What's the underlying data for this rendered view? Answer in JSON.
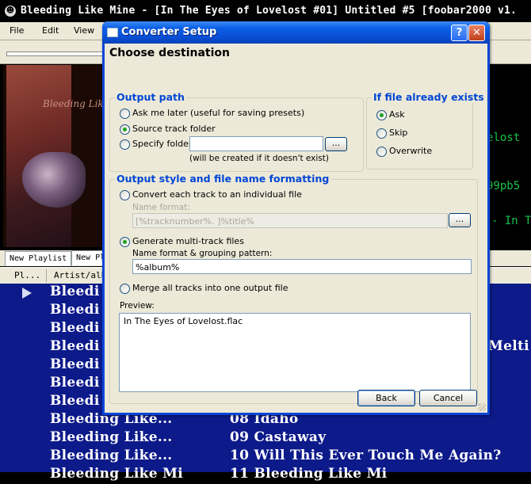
{
  "app": {
    "window_title": "Bleeding Like Mine - [In The Eyes of Lovelost #01] Untitled #5   [foobar2000 v1.",
    "menu": [
      "File",
      "Edit",
      "View"
    ],
    "info_lines": [
      "elost",
      "99pb5",
      "- In T"
    ],
    "cover_text": "Bleeding Like",
    "playlist_tabs": [
      "New Playlist",
      "New Pl"
    ],
    "columns": [
      "Pl...",
      "Artist/alb"
    ],
    "playlist_rows": [
      {
        "artist": "Bleedi",
        "title": "",
        "playing": true
      },
      {
        "artist": "Bleedi",
        "title": ""
      },
      {
        "artist": "Bleedi",
        "title": ""
      },
      {
        "artist": "Bleedi",
        "title": "Melti"
      },
      {
        "artist": "Bleedi",
        "title": ""
      },
      {
        "artist": "Bleedi",
        "title": ""
      },
      {
        "artist": "Bleedi",
        "title": ""
      },
      {
        "artist": "Bleeding Like...",
        "title": "08 Idaho"
      },
      {
        "artist": "Bleeding Like...",
        "title": "09 Castaway"
      },
      {
        "artist": "Bleeding Like...",
        "title": "10 Will This Ever Touch Me Again?"
      },
      {
        "artist": "Bleeding Like Mi",
        "title": "11 Bleeding Like Mi"
      }
    ]
  },
  "dialog": {
    "title": "Converter Setup",
    "help_glyph": "?",
    "close_glyph": "✕",
    "heading": "Choose destination",
    "output_path": {
      "title": "Output path",
      "options": [
        "Ask me later (useful for saving presets)",
        "Source track folder",
        "Specify folder:"
      ],
      "selected": 1,
      "folder_value": "",
      "browse_label": "...",
      "note": "(will be created if it doesn't exist)"
    },
    "if_exists": {
      "title": "If file already exists",
      "options": [
        "Ask",
        "Skip",
        "Overwrite"
      ],
      "selected": 0
    },
    "output_style": {
      "title": "Output style and file name formatting",
      "individual_label": "Convert each track to an individual file",
      "name_format_label": "Name format:",
      "name_format_value": "[%tracknumber%. ]%title%",
      "browse_label": "...",
      "multitrack_label": "Generate multi-track files",
      "grouping_label": "Name format & grouping pattern:",
      "grouping_value": "%album%",
      "merge_label": "Merge all tracks into one output file",
      "selected": 1
    },
    "preview": {
      "label": "Preview:",
      "text": "In The Eyes of Lovelost.flac"
    },
    "buttons": {
      "back": "Back",
      "cancel": "Cancel"
    }
  }
}
